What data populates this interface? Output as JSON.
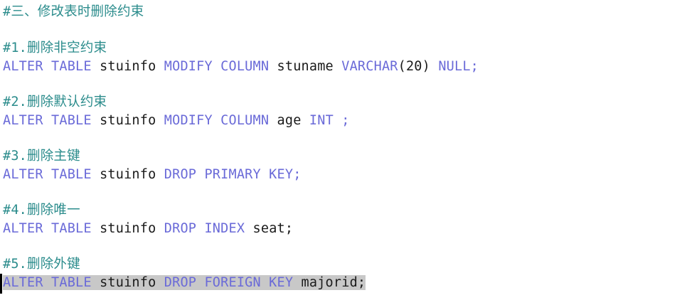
{
  "colors": {
    "comment": "#2b8c8c",
    "keyword": "#6a6ad8",
    "identifier": "#1a1a1a",
    "selection": "#c8c8c8",
    "background": "#ffffff"
  },
  "lines": {
    "heading": "#三、修改表时删除约束",
    "c1": "#1.删除非空约束",
    "s1": {
      "kw1": "ALTER TABLE",
      "id1": "stuinfo",
      "kw2": "MODIFY COLUMN",
      "id2": "stuname",
      "kw3": "VARCHAR",
      "paren": "(20)",
      "kw4": "NULL;"
    },
    "c2": "#2.删除默认约束",
    "s2": {
      "kw1": "ALTER TABLE",
      "id1": "stuinfo",
      "kw2": "MODIFY COLUMN",
      "id2": "age",
      "kw3": "INT ;"
    },
    "c3": "#3.删除主键",
    "s3": {
      "kw1": "ALTER TABLE",
      "id1": "stuinfo",
      "kw2": "DROP PRIMARY KEY;"
    },
    "c4": "#4.删除唯一",
    "s4": {
      "kw1": "ALTER TABLE",
      "id1": "stuinfo",
      "kw2": "DROP INDEX",
      "id2": "seat;"
    },
    "c5": "#5.删除外键",
    "s5": {
      "kw1": "ALTER TABLE",
      "id1": "stuinfo",
      "kw2": "DROP FOREIGN KEY",
      "id2": "majorid;"
    }
  }
}
